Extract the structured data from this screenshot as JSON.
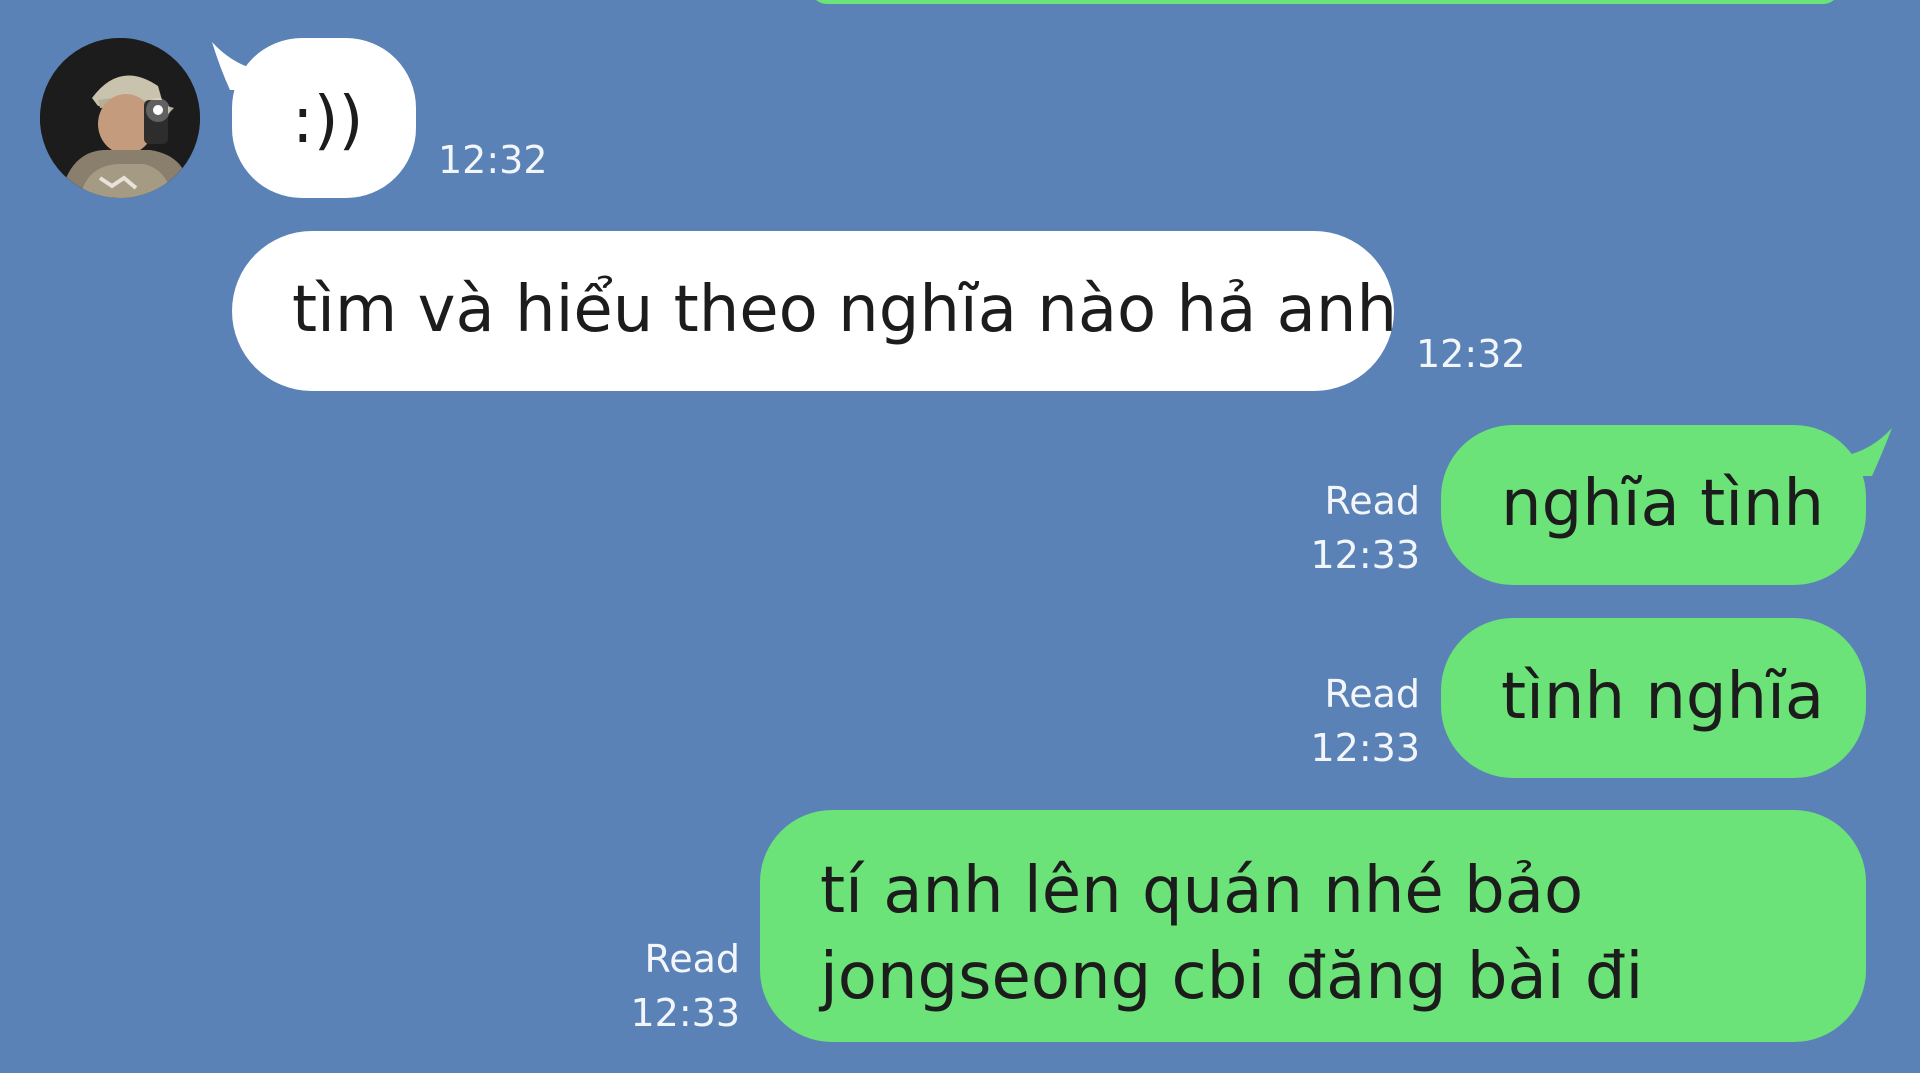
{
  "conversation": {
    "incoming": [
      {
        "text": ":))",
        "time": "12:32"
      },
      {
        "text": "tìm và hiểu theo nghĩa nào hả anh",
        "time": "12:32"
      }
    ],
    "outgoing": [
      {
        "text": "nghĩa tình",
        "status": "Read",
        "time": "12:33"
      },
      {
        "text": "tình nghĩa",
        "status": "Read",
        "time": "12:33"
      },
      {
        "lines": [
          "tí anh lên quán nhé bảo",
          "jongseong cbi đăng bài đi"
        ],
        "status": "Read",
        "time": "12:33"
      }
    ]
  },
  "colors": {
    "background": "#5a82b6",
    "incoming_bubble": "#ffffff",
    "outgoing_bubble": "#6be378",
    "meta_text": "#f2f6fb"
  }
}
